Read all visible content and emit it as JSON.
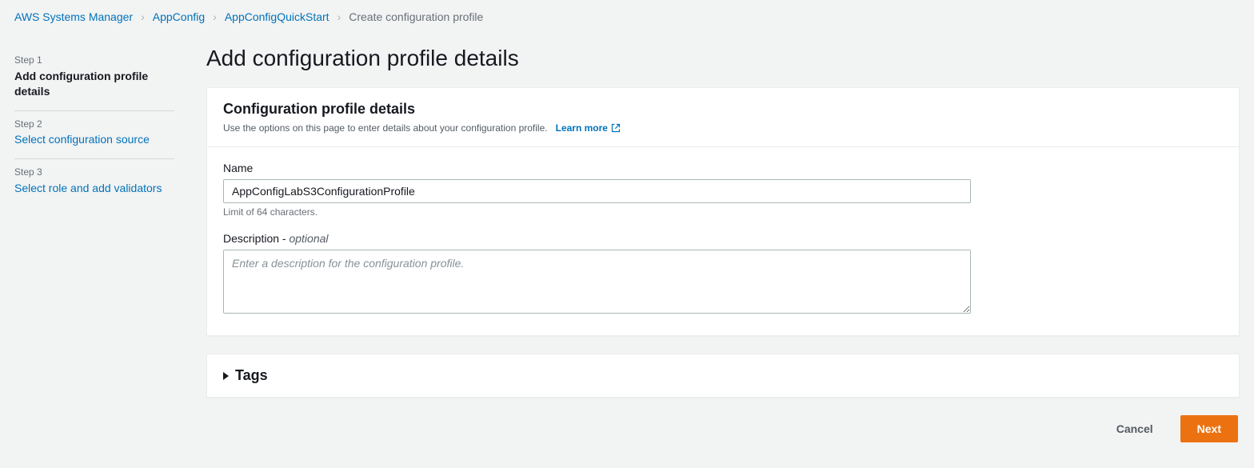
{
  "breadcrumb": {
    "items": [
      {
        "label": "AWS Systems Manager",
        "link": true
      },
      {
        "label": "AppConfig",
        "link": true
      },
      {
        "label": "AppConfigQuickStart",
        "link": true
      },
      {
        "label": "Create configuration profile",
        "link": false
      }
    ]
  },
  "steps": [
    {
      "index": "Step 1",
      "title": "Add configuration profile details",
      "active": true
    },
    {
      "index": "Step 2",
      "title": "Select configuration source",
      "active": false
    },
    {
      "index": "Step 3",
      "title": "Select role and add validators",
      "active": false
    }
  ],
  "page": {
    "heading": "Add configuration profile details"
  },
  "details": {
    "panel_title": "Configuration profile details",
    "panel_desc": "Use the options on this page to enter details about your configuration profile.",
    "learn_more": "Learn more",
    "name_label": "Name",
    "name_value": "AppConfigLabS3ConfigurationProfile",
    "name_hint": "Limit of 64 characters.",
    "desc_label": "Description - ",
    "desc_optional": "optional",
    "desc_value": "",
    "desc_placeholder": "Enter a description for the configuration profile."
  },
  "tags": {
    "title": "Tags"
  },
  "footer": {
    "cancel": "Cancel",
    "next": "Next"
  }
}
